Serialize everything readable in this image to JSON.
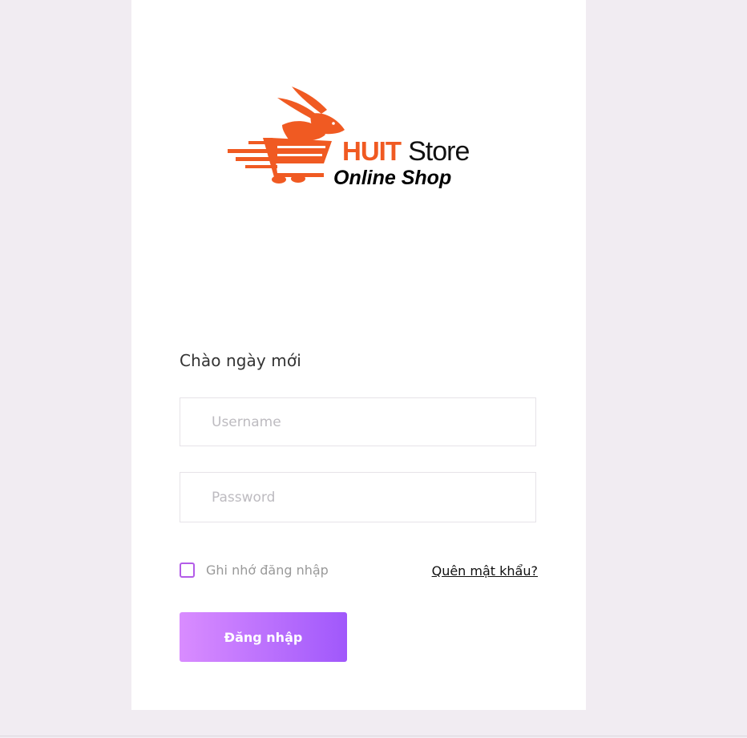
{
  "logo": {
    "brand_word": "HUIT",
    "store_word": "Store",
    "tagline": "Online Shop",
    "brand_color": "#f05a22",
    "icon": "rabbit-cart-icon"
  },
  "login": {
    "greeting": "Chào ngày mới",
    "username_placeholder": "Username",
    "password_placeholder": "Password",
    "remember_label": "Ghi nhớ đăng nhập",
    "forgot_label": "Quên mật khẩu?",
    "submit_label": "Đăng nhập",
    "accent_color": "#b35ce8"
  }
}
